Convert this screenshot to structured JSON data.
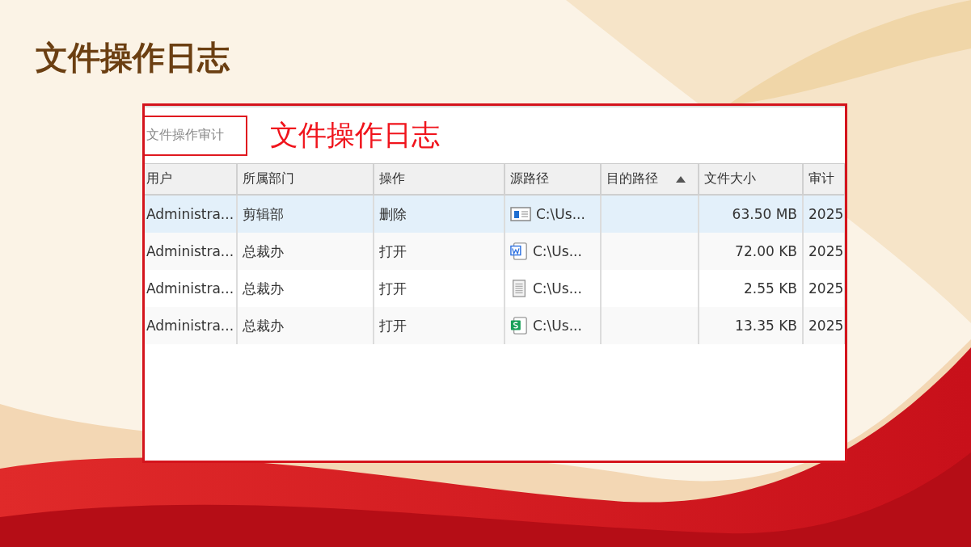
{
  "slide": {
    "title": "文件操作日志"
  },
  "screenshot": {
    "tab_label": "文件操作审计",
    "annotation": "文件操作日志",
    "table": {
      "columns": [
        {
          "label": "用户",
          "sorted": false
        },
        {
          "label": "所属部门",
          "sorted": false
        },
        {
          "label": "操作",
          "sorted": false
        },
        {
          "label": "源路径",
          "sorted": false
        },
        {
          "label": "目的路径",
          "sorted": true
        },
        {
          "label": "文件大小",
          "sorted": false
        },
        {
          "label": "审计",
          "sorted": false
        }
      ],
      "rows": [
        {
          "selected": true,
          "kind": "video",
          "cells": [
            "Administra...",
            "剪辑部",
            "删除",
            "C:\\Us...",
            "",
            "63.50 MB",
            "2025"
          ]
        },
        {
          "selected": false,
          "kind": "word",
          "cells": [
            "Administra...",
            "总裁办",
            "打开",
            "C:\\Us...",
            "",
            "72.00 KB",
            "2025"
          ]
        },
        {
          "selected": false,
          "kind": "text",
          "cells": [
            "Administra...",
            "总裁办",
            "打开",
            "C:\\Us...",
            "",
            "2.55 KB",
            "2025"
          ]
        },
        {
          "selected": false,
          "kind": "sheet",
          "cells": [
            "Administra...",
            "总裁办",
            "打开",
            "C:\\Us...",
            "",
            "13.35 KB",
            "2025"
          ]
        }
      ]
    }
  }
}
